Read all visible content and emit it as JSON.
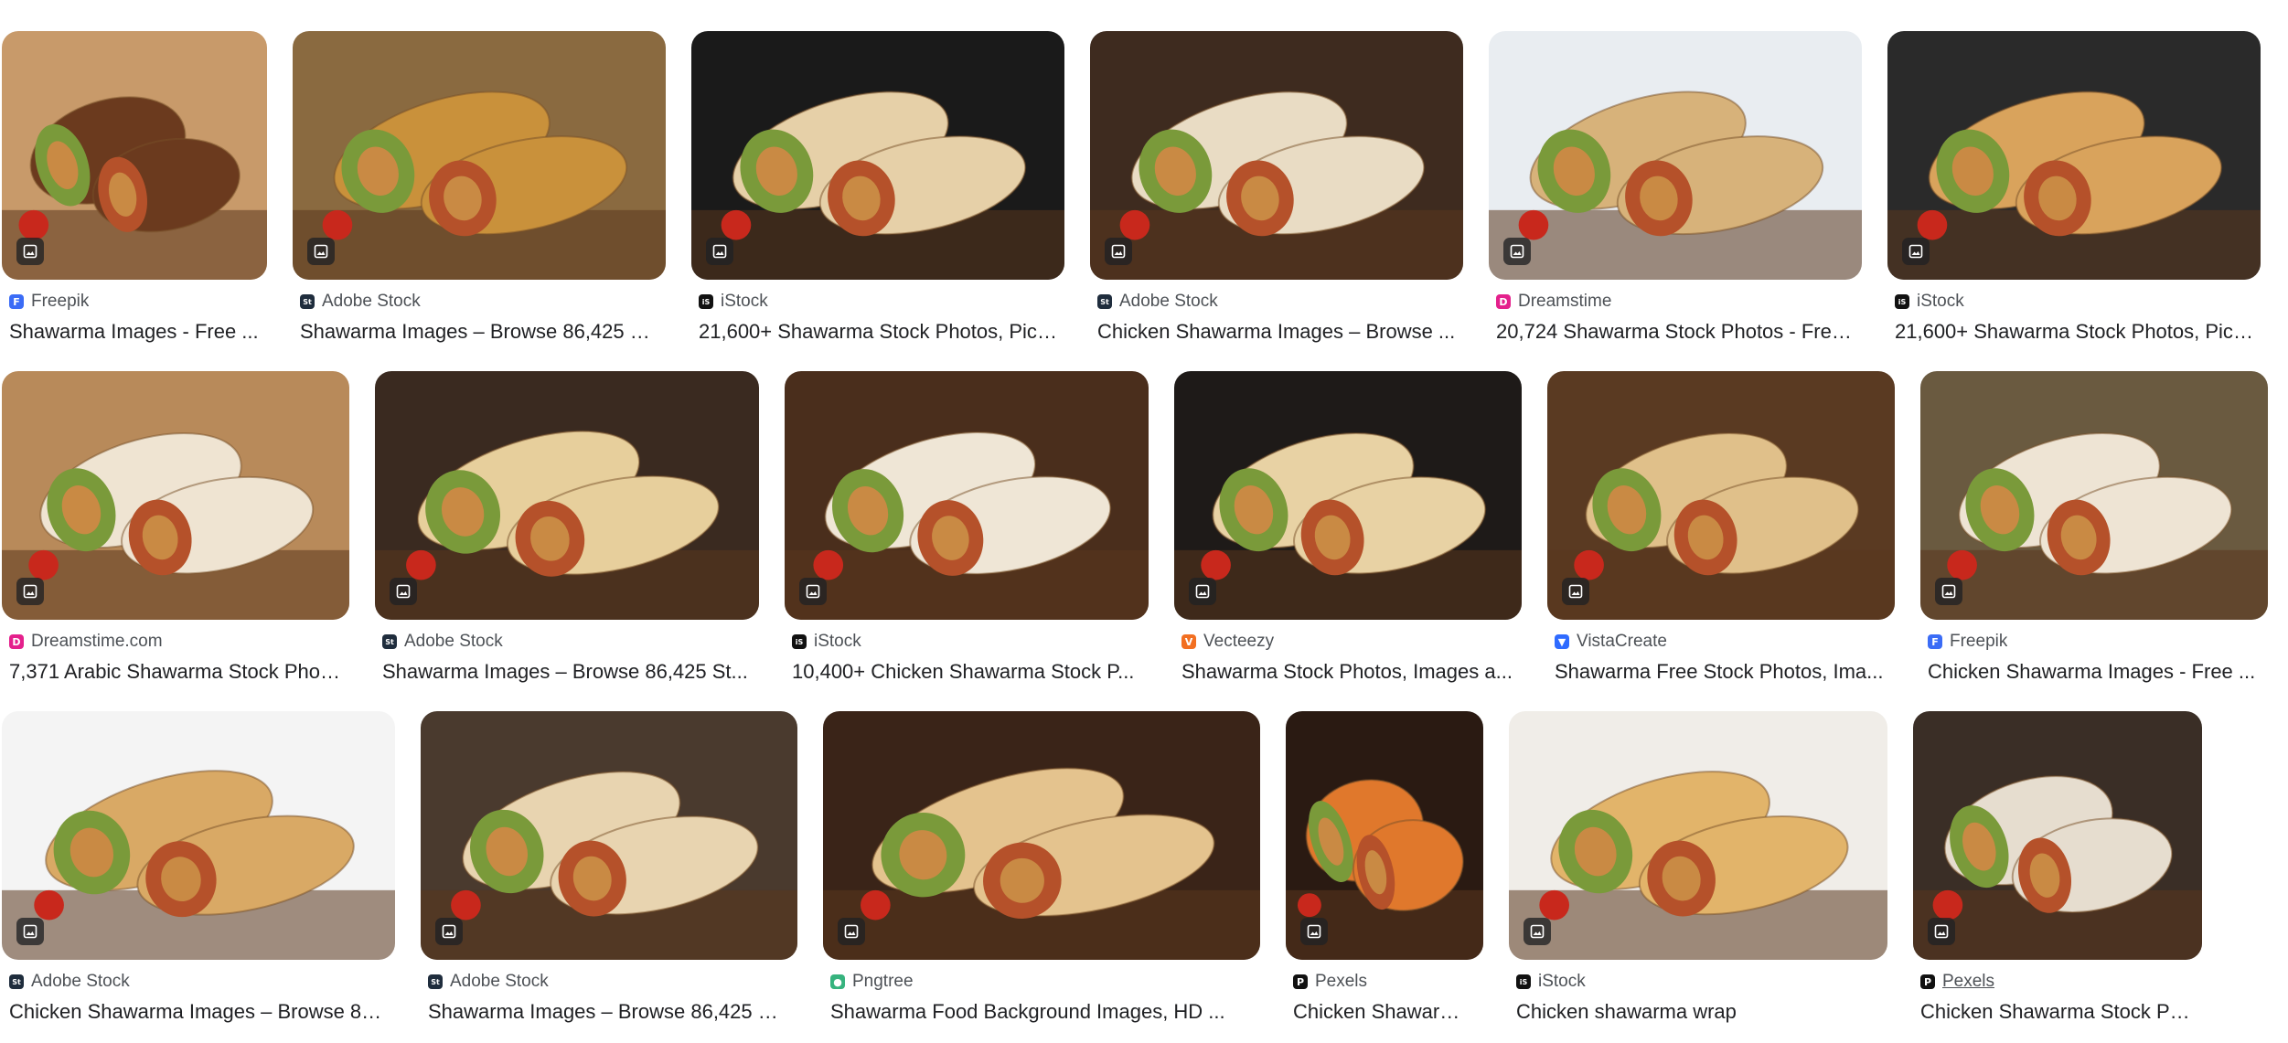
{
  "rows": [
    [
      {
        "source": "Freepik",
        "favicon": "freepik-icon",
        "title": "Shawarma Images - Free ...",
        "bg": "#c89a6a",
        "accent": "#6b3a1e"
      },
      {
        "source": "Adobe Stock",
        "favicon": "adobe-stock-icon",
        "title": "Shawarma Images – Browse 86,425 S...",
        "bg": "#8a6a40",
        "accent": "#c9913b"
      },
      {
        "source": "iStock",
        "favicon": "istock-icon",
        "title": "21,600+ Shawarma Stock Photos, Pict...",
        "bg": "#1a1a1a",
        "accent": "#e6d0a8"
      },
      {
        "source": "Adobe Stock",
        "favicon": "adobe-stock-icon",
        "title": "Chicken Shawarma Images – Browse ...",
        "bg": "#3e2b1f",
        "accent": "#e9dcc4"
      },
      {
        "source": "Dreamstime",
        "favicon": "dreamstime-icon",
        "title": "20,724 Shawarma Stock Photos - Free...",
        "bg": "#e9edf1",
        "accent": "#d7b27a"
      },
      {
        "source": "iStock",
        "favicon": "istock-icon",
        "title": "21,600+ Shawarma Stock Photos, Pict...",
        "bg": "#2a2a2a",
        "accent": "#d9a35c"
      }
    ],
    [
      {
        "source": "Dreamstime.com",
        "favicon": "dreamstime-icon",
        "title": "7,371 Arabic Shawarma Stock Phot...",
        "bg": "#b88a5a",
        "accent": "#efe4d2"
      },
      {
        "source": "Adobe Stock",
        "favicon": "adobe-stock-icon",
        "title": "Shawarma Images – Browse 86,425 St...",
        "bg": "#3a2a20",
        "accent": "#e7cf9c"
      },
      {
        "source": "iStock",
        "favicon": "istock-icon",
        "title": "10,400+ Chicken Shawarma Stock P...",
        "bg": "#4a2e1c",
        "accent": "#efe6d6"
      },
      {
        "source": "Vecteezy",
        "favicon": "vecteezy-icon",
        "title": "Shawarma Stock Photos, Images a...",
        "bg": "#1e1a18",
        "accent": "#e8d2a4"
      },
      {
        "source": "VistaCreate",
        "favicon": "vistacreate-icon",
        "title": "Shawarma Free Stock Photos, Ima...",
        "bg": "#5a3a22",
        "accent": "#e0c08a"
      },
      {
        "source": "Freepik",
        "favicon": "freepik-icon",
        "title": "Chicken Shawarma Images - Free ...",
        "bg": "#6a5a40",
        "accent": "#eee4d4"
      }
    ],
    [
      {
        "source": "Adobe Stock",
        "favicon": "adobe-stock-icon",
        "title": "Chicken Shawarma Images – Browse 87...",
        "bg": "#f4f4f4",
        "accent": "#d9a965"
      },
      {
        "source": "Adobe Stock",
        "favicon": "adobe-stock-icon",
        "title": "Shawarma Images – Browse 86,425 Sto...",
        "bg": "#4a3a2e",
        "accent": "#e8d4b0"
      },
      {
        "source": "Pngtree",
        "favicon": "pngtree-icon",
        "title": "Shawarma Food Background Images, HD ...",
        "bg": "#3a2418",
        "accent": "#e4c38e"
      },
      {
        "source": "Pexels",
        "favicon": "pexels-icon",
        "title": "Chicken Shawarma ...",
        "bg": "#2a1a12",
        "accent": "#e0782c"
      },
      {
        "source": "iStock",
        "favicon": "istock-icon",
        "title": "Chicken shawarma wrap",
        "bg": "#f0ede8",
        "accent": "#e2b46a"
      },
      {
        "source": "Pexels",
        "favicon": "pexels-icon",
        "title": "Chicken Shawarma Stock Ph...",
        "bg": "#3a2e26",
        "accent": "#e6ddcf"
      }
    ]
  ],
  "colors": {
    "freepik-icon": "#3b6cf6",
    "adobe-stock-icon": "#1f2d3d",
    "istock-icon": "#111111",
    "dreamstime-icon": "#e4208c",
    "vecteezy-icon": "#f26f21",
    "vistacreate-icon": "#2f6bff",
    "pngtree-icon": "#36b37e",
    "pexels-icon": "#111111"
  },
  "favicon_glyphs": {
    "freepik-icon": "F",
    "adobe-stock-icon": "St",
    "istock-icon": "iS",
    "dreamstime-icon": "D",
    "vecteezy-icon": "V",
    "vistacreate-icon": "▼",
    "pngtree-icon": "●",
    "pexels-icon": "P"
  }
}
